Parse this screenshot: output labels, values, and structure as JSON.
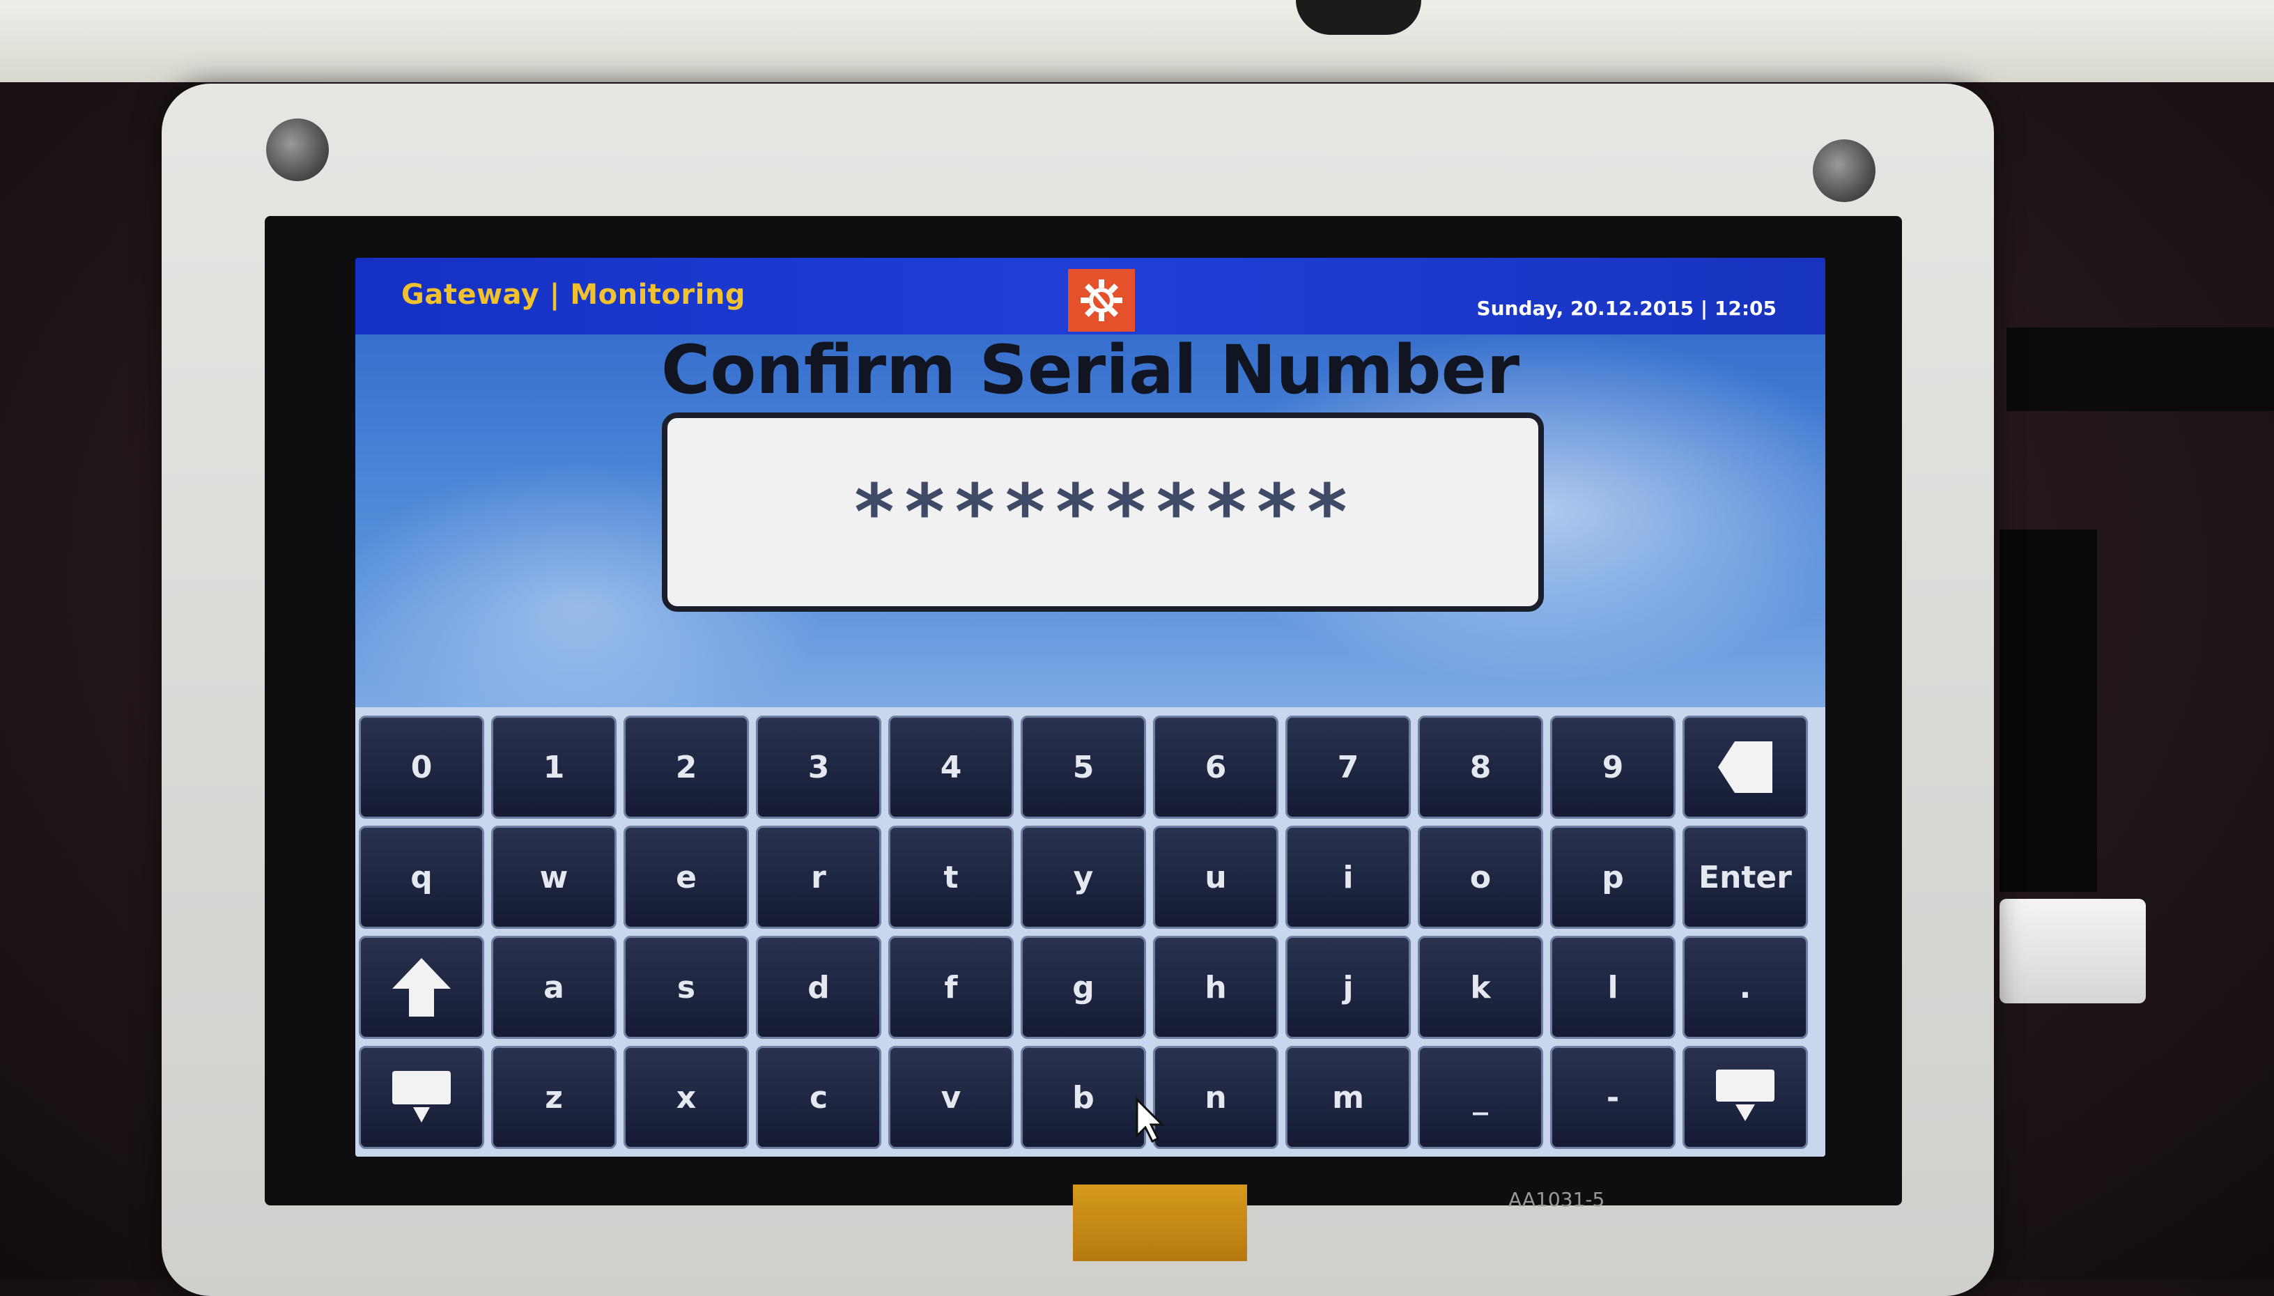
{
  "header": {
    "app_title": "Gateway | Monitoring",
    "settings_icon": "gear-wrench-icon",
    "datetime": "Sunday, 20.12.2015 | 12:05"
  },
  "page": {
    "title": "Confirm Serial Number",
    "serial_value": "**********"
  },
  "keyboard": {
    "row0": [
      "0",
      "1",
      "2",
      "3",
      "4",
      "5",
      "6",
      "7",
      "8",
      "9"
    ],
    "row1": [
      "q",
      "w",
      "e",
      "r",
      "t",
      "y",
      "u",
      "i",
      "o",
      "p"
    ],
    "row2": [
      "a",
      "s",
      "d",
      "f",
      "g",
      "h",
      "j",
      "k",
      "l",
      "."
    ],
    "row3": [
      "z",
      "x",
      "c",
      "v",
      "b",
      "n",
      "m",
      "_",
      "-"
    ],
    "enter_label": "Enter",
    "backspace_icon": "backspace-icon",
    "shift_icon": "shift-arrow-up-icon",
    "hide_icon": "keyboard-hide-icon",
    "scroll_icon": "arrow-down-icon"
  },
  "device": {
    "panel_code": "AA1031-5"
  },
  "colors": {
    "topbar": "#1f3fd6",
    "title_text": "#f2c12e",
    "settings_button": "#e5512b",
    "key_background": "#1c2340"
  }
}
